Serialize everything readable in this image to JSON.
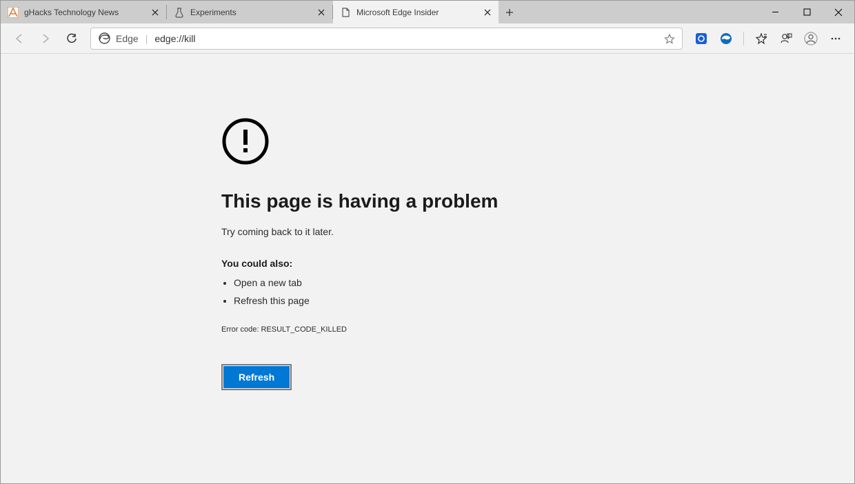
{
  "tabs": [
    {
      "title": "gHacks Technology News",
      "favicon": "ghacks"
    },
    {
      "title": "Experiments",
      "favicon": "flask"
    },
    {
      "title": "Microsoft Edge Insider",
      "favicon": "page"
    }
  ],
  "active_tab_index": 2,
  "omnibox": {
    "brand_label": "Edge",
    "url": "edge://kill"
  },
  "error": {
    "title": "This page is having a problem",
    "subtitle": "Try coming back to it later.",
    "could_also_label": "You could also:",
    "suggestions": [
      "Open a new tab",
      "Refresh this page"
    ],
    "error_code_label": "Error code:",
    "error_code": "RESULT_CODE_KILLED",
    "refresh_label": "Refresh"
  }
}
